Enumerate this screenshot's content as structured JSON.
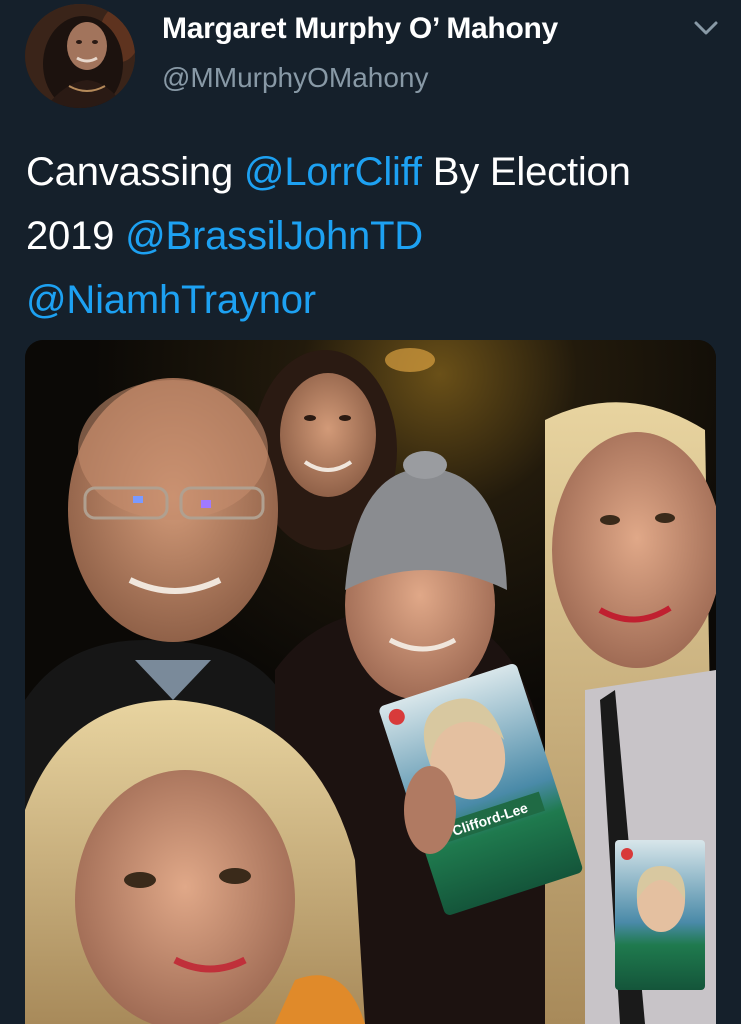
{
  "tweet": {
    "author": {
      "display_name": "Margaret Murphy O’ Mahony",
      "handle": "@MMurphyOMahony",
      "avatar_icon": "profile-photo"
    },
    "menu_icon": "chevron-down-icon",
    "text": {
      "part1": "Canvassing ",
      "mention1": "@LorrCliff",
      "part2": " By Election 2019 ",
      "mention2": "@BrassilJohnTD",
      "part3": " ",
      "mention3": "@NiamhTraynor"
    },
    "media": {
      "type": "photo",
      "leaflet_text": "Clifford-Lee"
    }
  },
  "colors": {
    "background": "#15202b",
    "text": "#ffffff",
    "secondary_text": "#8899a6",
    "link": "#1da1f2"
  }
}
